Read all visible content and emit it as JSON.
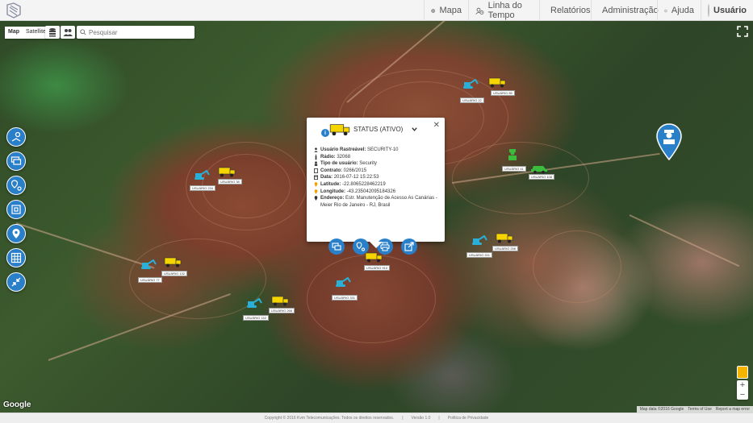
{
  "nav": {
    "items": [
      {
        "label": "Mapa",
        "icon": "globe-icon"
      },
      {
        "label": "Linha do Tempo",
        "icon": "timeline-icon"
      },
      {
        "label": "Relatórios",
        "icon": "report-icon"
      },
      {
        "label": "Administração",
        "icon": "gear-icon"
      },
      {
        "label": "Ajuda",
        "icon": "info-icon"
      }
    ],
    "user_label": "Usuário"
  },
  "map": {
    "type_map": "Map",
    "type_satellite": "Satellite",
    "search_placeholder": "Pesquisar",
    "zoom_in": "+",
    "zoom_out": "−",
    "google_logo": "Google",
    "attribution": [
      "Map data ©2016 Google",
      "Terms of Use",
      "Report a map error"
    ]
  },
  "markers": [
    {
      "label": "USUÁRIO 22",
      "type": "excavator",
      "color": "#2ab0d8"
    },
    {
      "label": "USUÁRIO 85",
      "type": "truck",
      "color": "#f5d400"
    },
    {
      "label": "USUÁRIO 234",
      "type": "excavator",
      "color": "#2ab0d8"
    },
    {
      "label": "USUÁRIO 38",
      "type": "truck",
      "color": "#f5d400"
    },
    {
      "label": "USUÁRIO 41",
      "type": "person",
      "color": "#3dbb3d"
    },
    {
      "label": "USUÁRIO 108",
      "type": "car",
      "color": "#3dbb3d"
    },
    {
      "label": "USUÁRIO 201",
      "type": "excavator",
      "color": "#2ab0d8"
    },
    {
      "label": "USUÁRIO 256",
      "type": "truck",
      "color": "#f5d400"
    },
    {
      "label": "USUÁRIO 77",
      "type": "excavator",
      "color": "#2ab0d8"
    },
    {
      "label": "USUÁRIO 132",
      "type": "truck",
      "color": "#f5d400"
    },
    {
      "label": "USUÁRIO 910",
      "type": "truck",
      "color": "#f5d400"
    },
    {
      "label": "USUÁRIO 331",
      "type": "excavator",
      "color": "#2ab0d8"
    },
    {
      "label": "USUÁRIO 152",
      "type": "excavator",
      "color": "#2ab0d8"
    },
    {
      "label": "USUÁRIO 266",
      "type": "truck",
      "color": "#f5d400"
    }
  ],
  "popup": {
    "status": "STATUS (ATIVO)",
    "fields": [
      {
        "label": "Usuário Rastreável:",
        "value": "SECURITY-10"
      },
      {
        "label": "Rádio:",
        "value": "32068"
      },
      {
        "label": "Tipo de usuário:",
        "value": "Security"
      },
      {
        "label": "Contrato:",
        "value": "0266/2015"
      },
      {
        "label": "Data:",
        "value": "2016-07-12  15:22:53"
      },
      {
        "label": "Latitude:",
        "value": "-22.8065228462219"
      },
      {
        "label": "Longitude:",
        "value": "-43.235042095184326"
      },
      {
        "label": "Endereço:",
        "value": "Estr. Manutenção de Acesso As Canárias - Meier Rio de Janeiro - RJ, Brasil"
      }
    ]
  },
  "footer": {
    "copyright": "Copyright © 2016 Kvm Telecomunicações. Todos os direitos reservados.",
    "version": "Versão 1.0",
    "privacy": "Politica de Privacidade"
  },
  "colors": {
    "accent": "#2a7fc9",
    "truck": "#f5d400",
    "excavator": "#2ab0d8",
    "vehicle_green": "#3dbb3d"
  }
}
